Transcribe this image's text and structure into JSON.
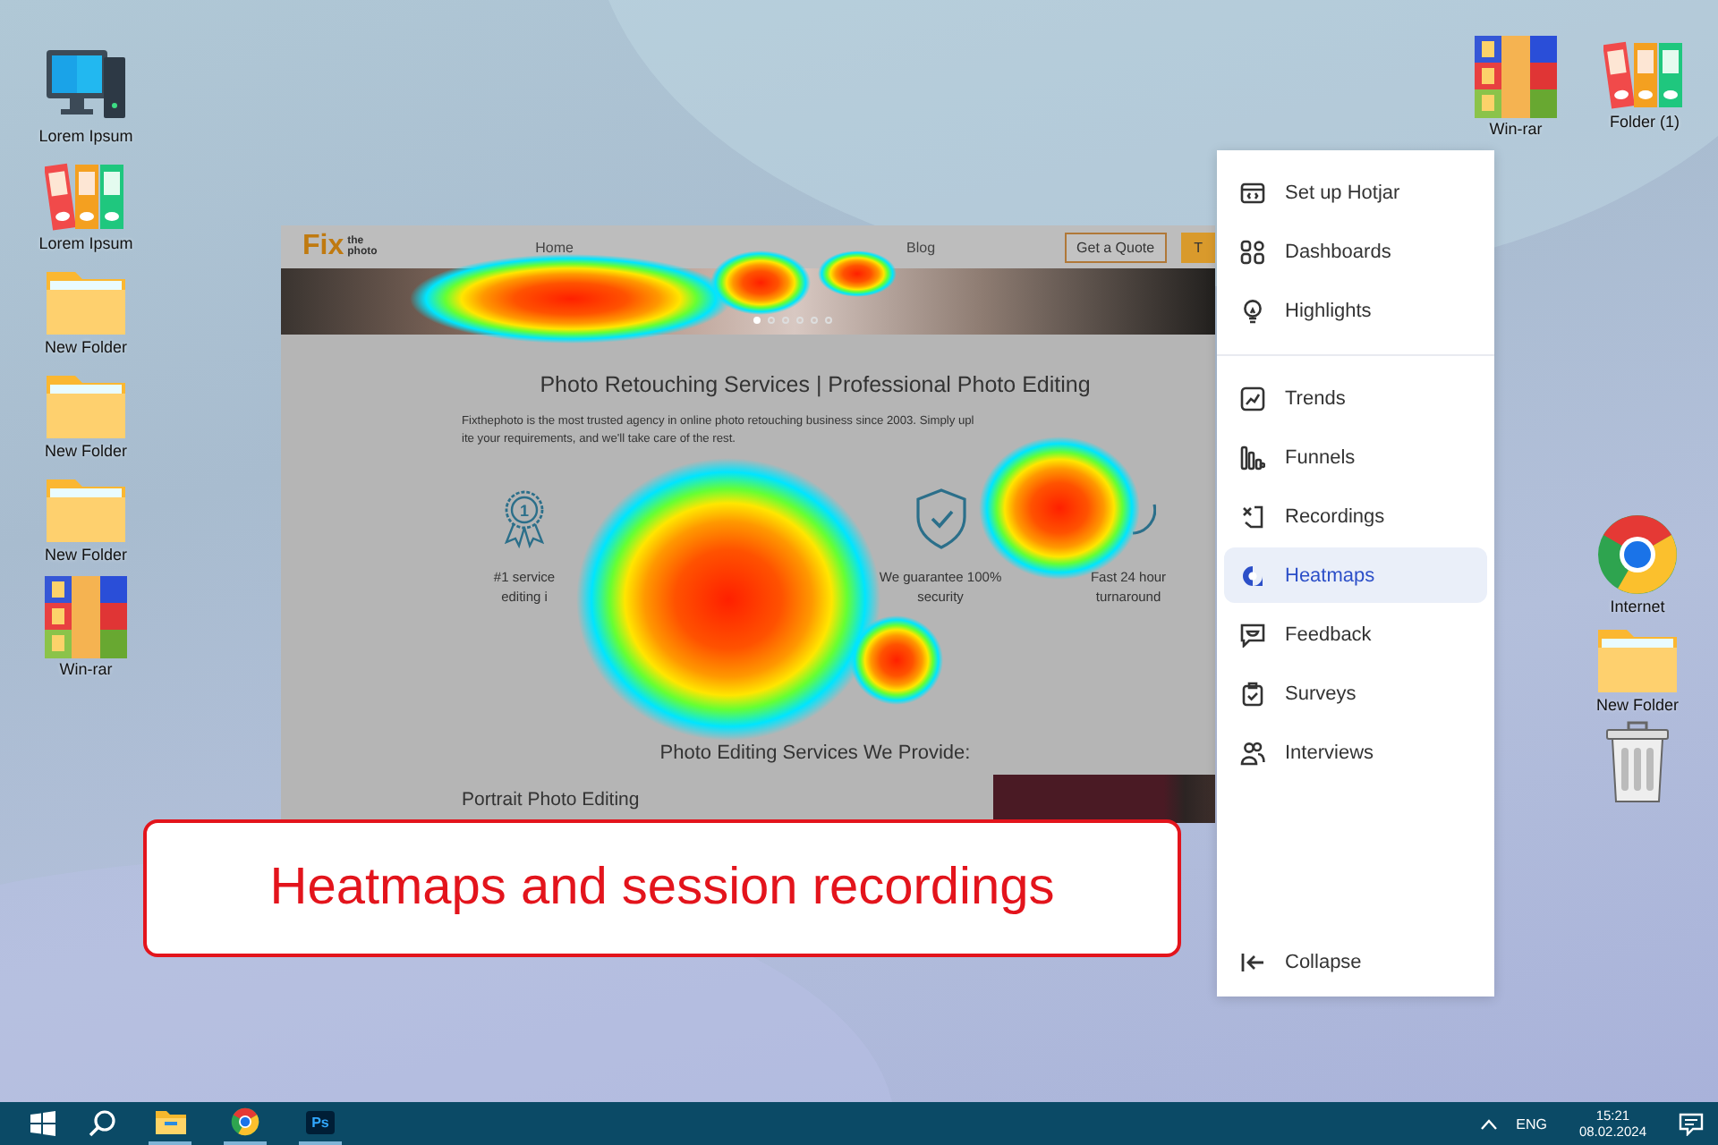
{
  "desktop_left": [
    {
      "label": "Lorem Ipsum",
      "kind": "computer"
    },
    {
      "label": "Lorem Ipsum",
      "kind": "binders"
    },
    {
      "label": "New Folder",
      "kind": "folder"
    },
    {
      "label": "New Folder",
      "kind": "folder"
    },
    {
      "label": "New Folder",
      "kind": "folder"
    },
    {
      "label": "Win-rar",
      "kind": "archive"
    }
  ],
  "desktop_top_right": [
    {
      "label": "Win-rar",
      "kind": "archive"
    },
    {
      "label": "Folder (1)",
      "kind": "binders"
    }
  ],
  "desktop_right": [
    {
      "label": "Internet",
      "kind": "browser"
    },
    {
      "label": "New Folder",
      "kind": "folder"
    },
    {
      "kind": "trash"
    }
  ],
  "website": {
    "logo": {
      "main": "Fix",
      "sub": "the photo"
    },
    "nav": [
      "Home",
      "Blog"
    ],
    "quote_button": "Get a Quote",
    "cut_button": "T",
    "carousel": [
      {
        "selected": true
      },
      {
        "selected": false
      },
      {
        "selected": false
      },
      {
        "selected": false
      },
      {
        "selected": false
      },
      {
        "selected": false
      }
    ],
    "title": "Photo Retouching Services | Professional Photo Editing",
    "intro": "Fixthephoto is the most trusted agency in online photo retouching business since 2003. Simply upl",
    "intro_2": "ite your requirements, and we'll take care of the rest.",
    "features": [
      {
        "kind": "ribbon",
        "badge": "1",
        "text": "#1 service editing i"
      },
      {
        "kind": "shield",
        "text": "We guarantee 100% security"
      },
      {
        "kind": "clock",
        "text": "Fast 24 hour turnaround"
      }
    ],
    "services_heading": "Photo Editing Services We Provide:",
    "service_title": "Portrait Photo Editing"
  },
  "menu": {
    "sections": [
      [
        {
          "label": "Set up Hotjar",
          "kind": "code",
          "selected": false
        },
        {
          "label": "Dashboards",
          "kind": "grid",
          "selected": false
        },
        {
          "label": "Highlights",
          "kind": "bulb",
          "selected": false
        }
      ],
      [
        {
          "label": "Trends",
          "kind": "trend",
          "selected": false
        },
        {
          "label": "Funnels",
          "kind": "funnel",
          "selected": false
        },
        {
          "label": "Recordings",
          "kind": "recording",
          "selected": false
        },
        {
          "label": "Heatmaps",
          "kind": "heatmap",
          "selected": true
        },
        {
          "label": "Feedback",
          "kind": "feedback",
          "selected": false
        },
        {
          "label": "Surveys",
          "kind": "survey",
          "selected": false
        },
        {
          "label": "Interviews",
          "kind": "people",
          "selected": false
        }
      ]
    ],
    "collapse": "Collapse"
  },
  "caption": "Heatmaps and session recordings",
  "taskbar": {
    "apps": [
      {
        "kind": "explorer",
        "running": true
      },
      {
        "kind": "browser",
        "running": true
      },
      {
        "kind": "photoshop",
        "label": "Ps",
        "running": true
      }
    ],
    "language": "ENG",
    "time": "15:21",
    "date": "08.02.2024"
  }
}
